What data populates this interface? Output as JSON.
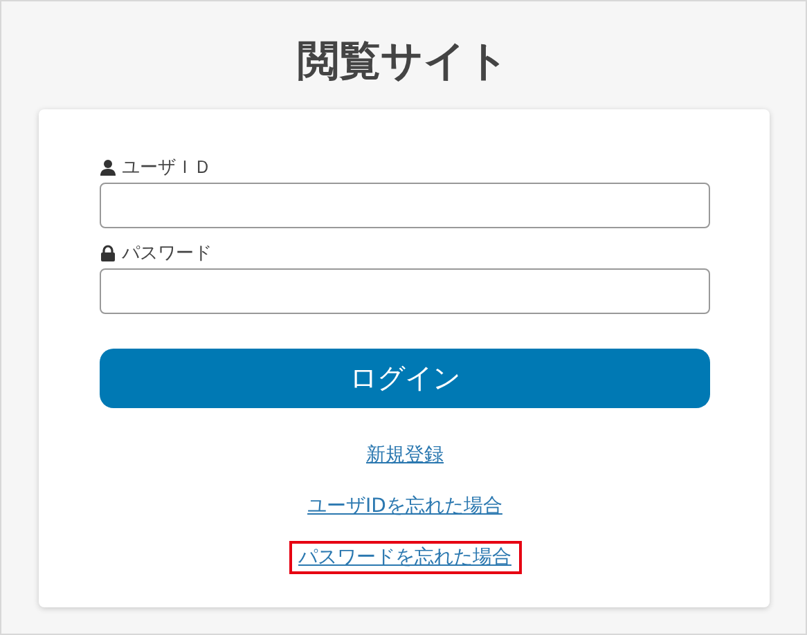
{
  "title": "閲覧サイト",
  "fields": [
    {
      "kind": "user",
      "label": "ユーザＩＤ"
    },
    {
      "kind": "lock",
      "label": "パスワード"
    }
  ],
  "login_button": "ログイン",
  "links": [
    {
      "label": "新規登録",
      "highlighted": false
    },
    {
      "label": "ユーザIDを忘れた場合",
      "highlighted": false
    },
    {
      "label": "パスワードを忘れた場合",
      "highlighted": true
    }
  ]
}
